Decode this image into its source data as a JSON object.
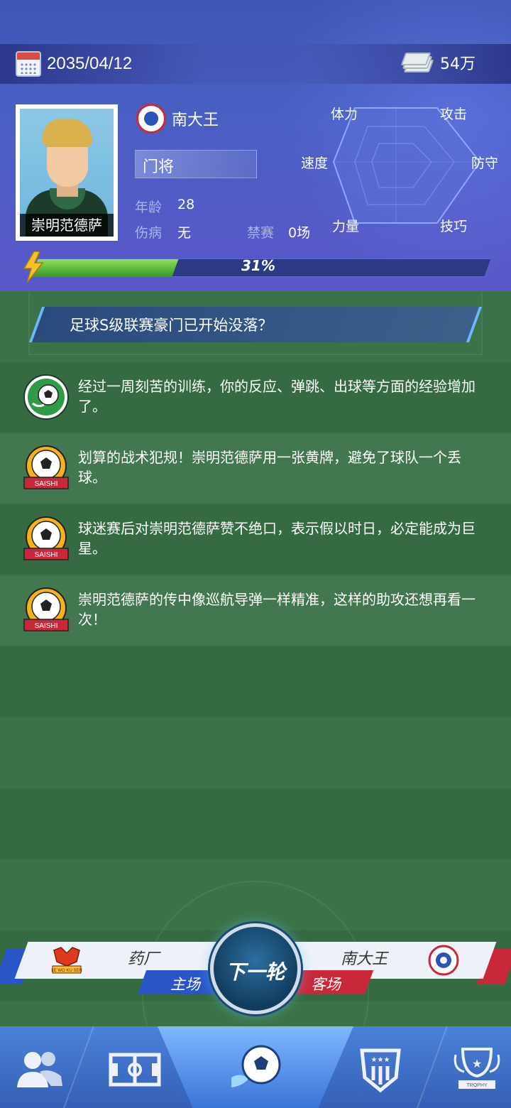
{
  "topbar": {
    "date": "2035/04/12",
    "money": "54万",
    "icons": [
      "calendar-icon",
      "cash-icon"
    ]
  },
  "player": {
    "name": "崇明范德萨",
    "team": "南大王",
    "position": "门将",
    "age_label": "年龄",
    "age": "28",
    "injury_label": "伤病",
    "injury": "无",
    "suspension_label": "禁赛",
    "suspension": "0场"
  },
  "radar": {
    "labels": {
      "stamina": "体力",
      "attack": "攻击",
      "speed": "速度",
      "defense": "防守",
      "power": "力量",
      "skill": "技巧"
    }
  },
  "energy": {
    "percent_text": "31%",
    "value": 0.31,
    "icon": "lightning-icon"
  },
  "headline": "足球S级联赛豪门已开始没落？",
  "news": [
    {
      "icon": "soccer-ball-icon",
      "text": "经过一周刻苦的训练，你的反应、弹跳、出球等方面的经验增加了。"
    },
    {
      "icon": "saishi-badge-icon",
      "text": "划算的战术犯规！崇明范德萨用一张黄牌，避免了球队一个丢球。"
    },
    {
      "icon": "saishi-badge-icon",
      "text": "球迷赛后对崇明范德萨赞不绝口，表示假以时日，必定能成为巨星。"
    },
    {
      "icon": "saishi-badge-icon",
      "text": "崇明范德萨的传中像巡航导弹一样精准，这样的助攻还想再看一次！"
    }
  ],
  "match": {
    "home_team": "药厂",
    "home_tag": "主场",
    "away_team": "南大王",
    "away_tag": "客场",
    "next_label": "下一轮",
    "home_badge_text": "LE WO KU SEN"
  },
  "tabbar": {
    "items": [
      "players-icon",
      "tactics-field-icon",
      "match-ball-icon",
      "league-shield-icon",
      "trophy-icon"
    ],
    "trophy_text": "TROPHY"
  },
  "saishi_text": "SAISHI",
  "colors": {
    "header": "#4a5fc4",
    "field": "#3c7248",
    "home": "#2a55c8",
    "away": "#c8283a",
    "energy": "#5cc23a"
  }
}
